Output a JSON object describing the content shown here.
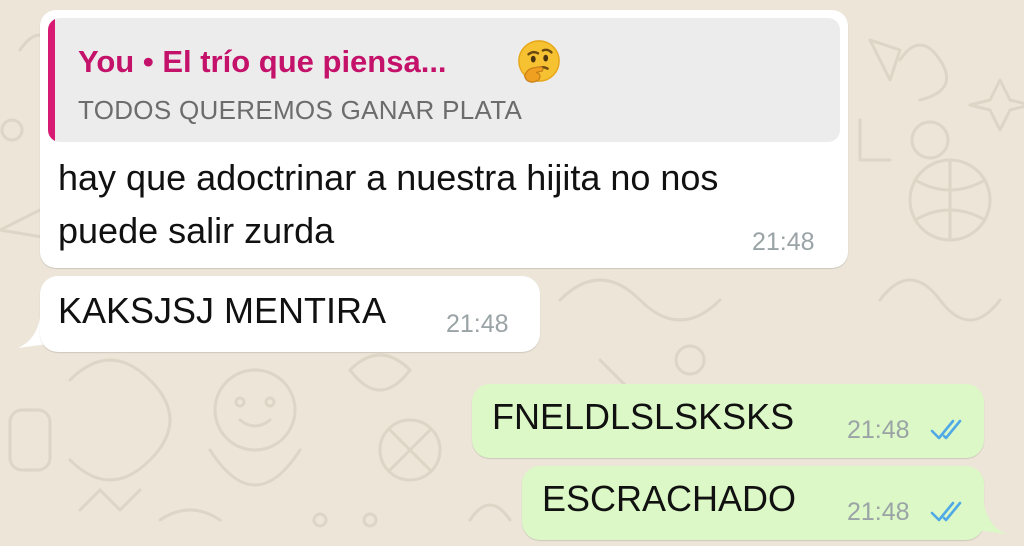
{
  "theme": {
    "wallpaper": "#ece5d8",
    "incoming_bubble": "#ffffff",
    "outgoing_bubble": "#dcf8c6",
    "quote_accent": "#d81b72",
    "read_ticks": "#4fa9e6"
  },
  "messages": [
    {
      "direction": "incoming",
      "quote": {
        "author": "You • El trío que piensa...",
        "emoji": "thinking-face-icon",
        "text": "TODOS QUEREMOS GANAR PLATA"
      },
      "text_lines": [
        "hay que adoctrinar a nuestra hijita no nos",
        "puede salir zurda"
      ],
      "time": "21:48"
    },
    {
      "direction": "incoming",
      "text": "KAKSJSJ MENTIRA",
      "time": "21:48"
    },
    {
      "direction": "outgoing",
      "text": "FNELDLSLSKSKS",
      "time": "21:48",
      "status": "read-double-check-icon"
    },
    {
      "direction": "outgoing",
      "text": "ESCRACHADO",
      "time": "21:48",
      "status": "read-double-check-icon"
    }
  ]
}
